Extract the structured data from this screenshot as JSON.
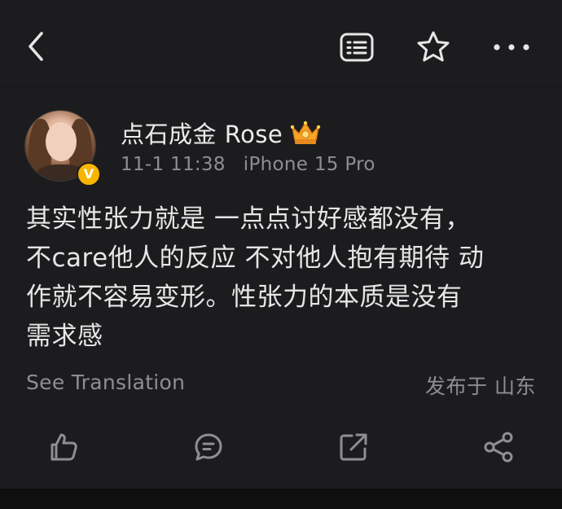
{
  "header": {
    "back_icon": "chevron-left-icon",
    "reader_icon": "reader-mode-icon",
    "favorite_icon": "star-icon",
    "more_icon": "more-horizontal-icon"
  },
  "post": {
    "author": {
      "name": "点石成金 Rose",
      "verified_badge": "V",
      "crown_icon": "crown-icon",
      "badge_color": "#f7b500"
    },
    "timestamp": "11-1 11:38",
    "device": "iPhone 15 Pro",
    "content_lines": [
      "其实性张力就是 一点点讨好感都没有，",
      "不care他人的反应 不对他人抱有期待 动",
      "作就不容易变形。性张力的本质是没有",
      "需求感"
    ],
    "translate_label": "See Translation",
    "location_label": "发布于 山东"
  },
  "actions": {
    "like_icon": "thumbs-up-icon",
    "comment_icon": "comment-icon",
    "repost_icon": "repost-icon",
    "share_icon": "share-icon"
  },
  "colors": {
    "background": "#1c1c1e",
    "text_primary": "#e6e6e6",
    "text_secondary": "#8e8e93",
    "crown": "#f5a623"
  }
}
